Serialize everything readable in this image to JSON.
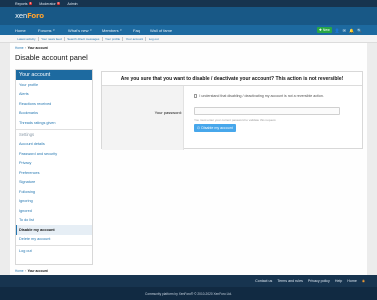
{
  "staffbar": {
    "reports_label": "Reports",
    "reports_count": "1",
    "moderator_label": "Moderator",
    "admin_label": "Admin"
  },
  "header": {
    "logo_prefix": "xen",
    "logo_suffix": "Foro"
  },
  "nav": {
    "items": [
      {
        "label": "Home"
      },
      {
        "label": "Forums"
      },
      {
        "label": "What's new"
      },
      {
        "label": "Members"
      },
      {
        "label": "Faq"
      },
      {
        "label": "Wall of fame"
      }
    ],
    "new_label": "New"
  },
  "subnav": [
    "Latest activity",
    "Your news feed",
    "Search direct messages",
    "Your profile",
    "Your account",
    "Log out"
  ],
  "breadcrumb": {
    "home": "Home",
    "separator": "›",
    "current": "Your account"
  },
  "page_title": "Disable account panel",
  "sidebar": {
    "header": "Your account",
    "group1": [
      "Your profile",
      "Alerts",
      "Reactions received",
      "Bookmarks",
      "Threads ratings given"
    ],
    "settings_header": "Settings",
    "group2": [
      "Account details",
      "Password and security",
      "Privacy",
      "Preferences",
      "Signature",
      "Following",
      "Ignoring",
      "Ignored",
      "To do list"
    ],
    "active": "Disable my account",
    "group3": [
      "Delete my account"
    ],
    "logout": "Log out"
  },
  "panel": {
    "title": "Are you sure that you want to disable / deactivate your account? This action is not reversible!",
    "checkbox_label": "I understand that disabling / deactivating my account is not a reversible action.",
    "password_label": "Your password:",
    "password_value": "",
    "hint": "You must enter your current password to validate this request.",
    "button_label": "Disable my account"
  },
  "footer": {
    "links": [
      "Contact us",
      "Terms and rules",
      "Privacy policy",
      "Help",
      "Home"
    ],
    "copyright": "Community platform by XenForo® © 2010-2020 XenForo Ltd."
  },
  "colors": {
    "header": "#185886",
    "nav": "#1d6aa0",
    "staffbar": "#17344f",
    "accent": "#2577b1",
    "button": "#47a7eb",
    "new_button": "#28a745"
  }
}
